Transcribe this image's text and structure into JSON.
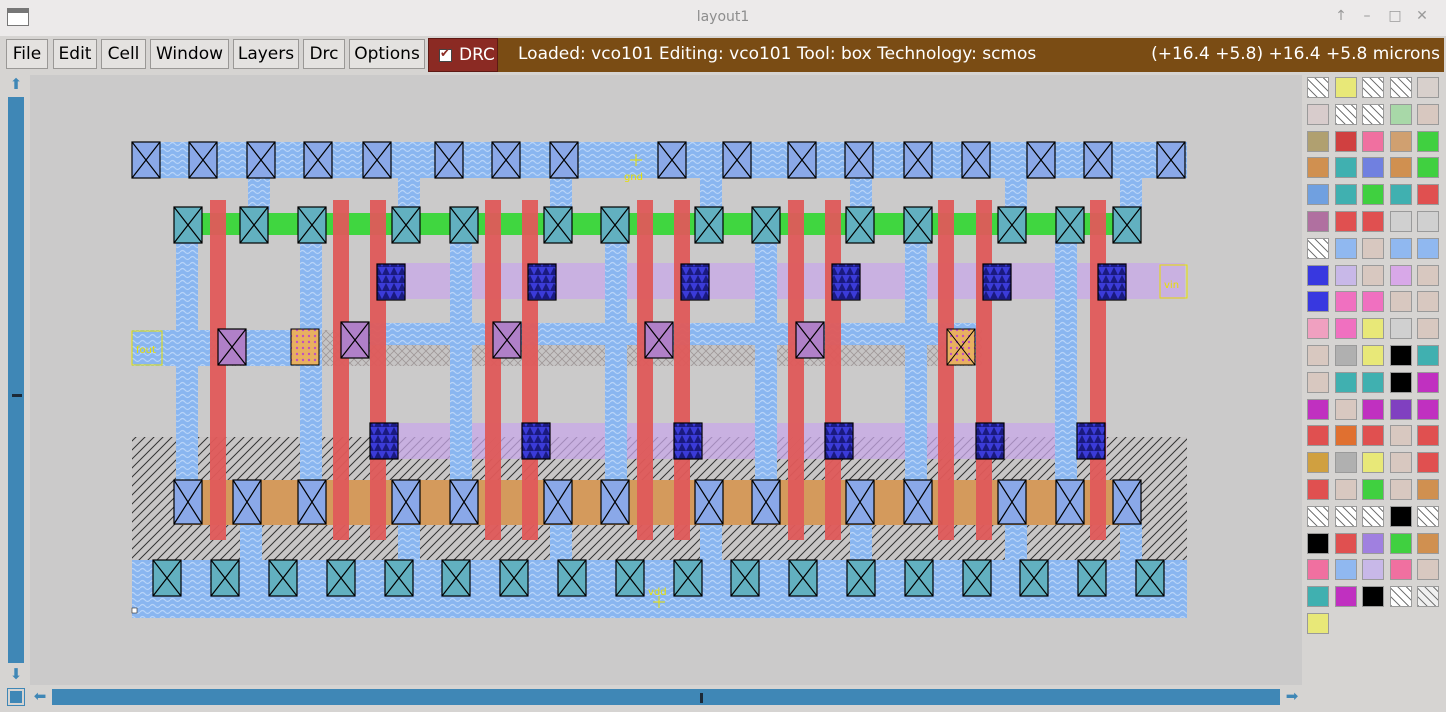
{
  "window": {
    "title": "layout1",
    "controls": [
      "↑",
      "–",
      "□",
      "✕"
    ]
  },
  "menu": {
    "items": [
      "File",
      "Edit",
      "Cell",
      "Window",
      "Layers",
      "Drc",
      "Options"
    ]
  },
  "drc": {
    "label": "DRC",
    "checked": true
  },
  "status": {
    "text": "Loaded: vco101 Editing: vco101 Tool: box  Technology: scmos",
    "coords": "(+16.4 +5.8) +16.4 +5.8 microns"
  },
  "layout": {
    "labels": {
      "gnd": "gnd",
      "vdd": "vdd",
      "vin": "vin",
      "fout": "fout"
    },
    "colors": {
      "metal1": "#88b4f0",
      "metal2": "#c8a8e8",
      "poly": "#e05a5a",
      "contact": "#62b0c0",
      "via": "#3838e0",
      "diff_n": "#40e040",
      "diff_p": "#d09050",
      "nwell": "#333333",
      "label": "#e8e000"
    }
  },
  "palette": {
    "colors": [
      "#ffffff",
      "#e8e878",
      "#ffffff",
      "#ffffff",
      "#d8d0cc",
      "#d8cccc",
      "#ffffff",
      "#ffffff",
      "#a8d8a8",
      "#d8c8c0",
      "#b0a070",
      "#d04040",
      "#f070a0",
      "#d0a070",
      "#40d040",
      "#d09050",
      "#40b0b0",
      "#7080e0",
      "#d09050",
      "#40d040",
      "#70a0e0",
      "#40b0b0",
      "#40d040",
      "#40b0b0",
      "#e05050",
      "#b070a0",
      "#e05050",
      "#e05050",
      "#d0d0d0",
      "#d0d0d0",
      "#ffffff",
      "#90b8f0",
      "#d8c8c0",
      "#90b8f0",
      "#90b8f0",
      "#3838e0",
      "#c8b8e8",
      "#d8c8c0",
      "#d8a8e8",
      "#d8c8c0",
      "#3838e0",
      "#f070c0",
      "#f070c0",
      "#d8c8c0",
      "#d8c8c0",
      "#f0a0c0",
      "#f070c0",
      "#e8e878",
      "#d0d0d0",
      "#d8c8c0",
      "#d8c8c0",
      "#b0b0b0",
      "#e8e878",
      "#000000",
      "#40b0b0",
      "#d8c8c0",
      "#40b0b0",
      "#40b0b0",
      "#000000",
      "#c030c0",
      "#c030c0",
      "#d8c8c0",
      "#c030c0",
      "#8040c0",
      "#c030c0",
      "#e05050",
      "#e07030",
      "#e05050",
      "#d8c8c0",
      "#e05050",
      "#d0a040",
      "#b0b0b0",
      "#e8e878",
      "#d8c8c0",
      "#e05050",
      "#e05050",
      "#d8c8c0",
      "#40d040",
      "#d8c8c0",
      "#d09050",
      "#ffffff",
      "#ffffff",
      "#ffffff",
      "#000000",
      "#ffffff",
      "#000000",
      "#e05050",
      "#a080e0",
      "#40d040",
      "#d09050",
      "#f070a0",
      "#90b8f0",
      "#c8b8e8",
      "#f070a0",
      "#d8c8c0",
      "#40b0b0",
      "#c030c0",
      "#000000",
      "#ffffff",
      "#f0f0f0",
      "#e8e878"
    ]
  }
}
